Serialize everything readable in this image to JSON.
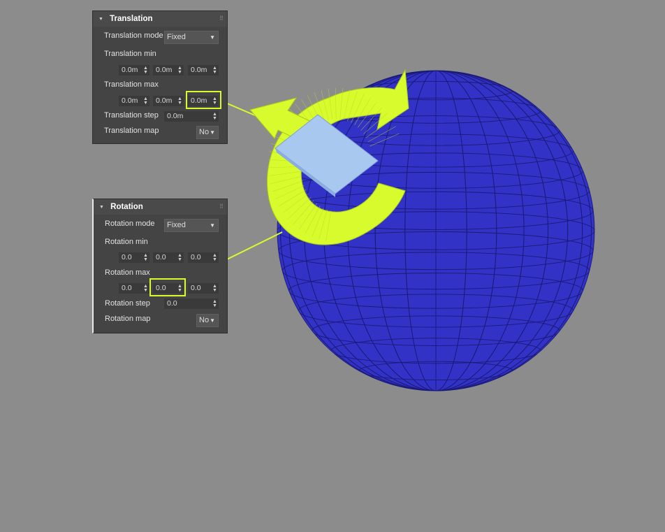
{
  "accent_color": "#d7fb2c",
  "sphere_color": "#3030c4",
  "translation": {
    "title": "Translation",
    "mode_label": "Translation mode",
    "mode_value": "Fixed",
    "min_label": "Translation min",
    "min_values": [
      "0.0m",
      "0.0m",
      "0.0m"
    ],
    "max_label": "Translation max",
    "max_values": [
      "0.0m",
      "0.0m",
      "0.0m"
    ],
    "step_label": "Translation step",
    "step_value": "0.0m",
    "map_label": "Translation map",
    "map_value": "No"
  },
  "rotation": {
    "title": "Rotation",
    "mode_label": "Rotation mode",
    "mode_value": "Fixed",
    "min_label": "Rotation min",
    "min_values": [
      "0.0",
      "0.0",
      "0.0"
    ],
    "max_label": "Rotation max",
    "max_values": [
      "0.0",
      "0.0",
      "0.0"
    ],
    "step_label": "Rotation step",
    "step_value": "0.0",
    "map_label": "Rotation map",
    "map_value": "No"
  },
  "icons": {
    "collapse": "triangle-down-icon",
    "grip": "drag-grip-icon",
    "spinner": "spinner-arrows-icon",
    "dropdown": "chevron-down-icon",
    "translate_gizmo": "translate-arrow-icon",
    "rotate_gizmo": "rotate-arrow-icon"
  }
}
